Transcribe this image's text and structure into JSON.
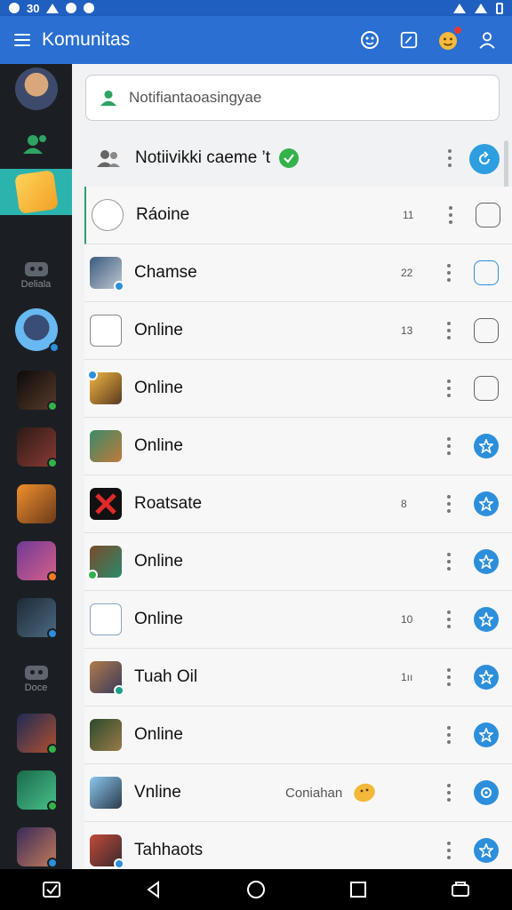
{
  "status_bar": {
    "time": "30"
  },
  "app_bar": {
    "title": "Komunitas"
  },
  "sidebar": {
    "items": [
      {
        "label": ""
      },
      {
        "label": ""
      },
      {
        "label": ""
      },
      {
        "label": "Deliala"
      },
      {
        "label": ""
      },
      {
        "label": ""
      },
      {
        "label": ""
      },
      {
        "label": ""
      },
      {
        "label": ""
      },
      {
        "label": ""
      },
      {
        "label": "Doce"
      },
      {
        "label": ""
      },
      {
        "label": ""
      },
      {
        "label": ""
      }
    ]
  },
  "search": {
    "placeholder": "Notifiantaoasingyae"
  },
  "header": {
    "title": "Notiivikki caeme ’t"
  },
  "rows": [
    {
      "name": "Ráoine",
      "count": "11",
      "sub": ""
    },
    {
      "name": "Chamse",
      "count": "22",
      "sub": ""
    },
    {
      "name": "Online",
      "count": "13",
      "sub": ""
    },
    {
      "name": "Online",
      "count": "",
      "sub": ""
    },
    {
      "name": "Online",
      "count": "",
      "sub": ""
    },
    {
      "name": "Roatsate",
      "count": "8",
      "sub": ""
    },
    {
      "name": "Online",
      "count": "",
      "sub": ""
    },
    {
      "name": "Online",
      "count": "10",
      "sub": ""
    },
    {
      "name": "Tuah Oil",
      "count": "1ıı",
      "sub": ""
    },
    {
      "name": "Online",
      "count": "",
      "sub": ""
    },
    {
      "name": "Vnline",
      "count": "",
      "sub": "Coniahan"
    },
    {
      "name": "Tahhaots",
      "count": "",
      "sub": ""
    }
  ],
  "colors": {
    "accent": "#2a6fd1",
    "sidebar": "#1b1f24",
    "active": "#2bb3ad",
    "online": "#34b24a"
  }
}
